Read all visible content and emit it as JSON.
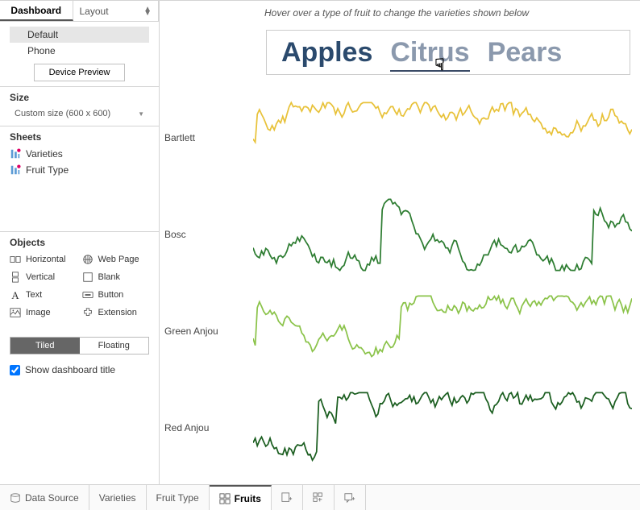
{
  "tabs": {
    "dashboard": "Dashboard",
    "layout": "Layout"
  },
  "devices": {
    "items": [
      "Default",
      "Phone"
    ],
    "preview_btn": "Device Preview"
  },
  "size": {
    "head": "Size",
    "value": "Custom size (600 x 600)"
  },
  "sheets": {
    "head": "Sheets",
    "items": [
      "Varieties",
      "Fruit Type"
    ]
  },
  "objects": {
    "head": "Objects",
    "items": [
      {
        "label": "Horizontal"
      },
      {
        "label": "Web Page"
      },
      {
        "label": "Vertical"
      },
      {
        "label": "Blank"
      },
      {
        "label": "Text"
      },
      {
        "label": "Button"
      },
      {
        "label": "Image"
      },
      {
        "label": "Extension"
      }
    ]
  },
  "placement": {
    "tiled": "Tiled",
    "floating": "Floating"
  },
  "show_title": "Show dashboard title",
  "canvas": {
    "hint": "Hover over a type of fruit to change the varieties shown below",
    "fruits": {
      "apples": "Apples",
      "citrus": "Citrus",
      "pears": "Pears"
    }
  },
  "chart_data": {
    "type": "line",
    "rows": [
      {
        "name": "Bartlett",
        "color": "#e8c23a"
      },
      {
        "name": "Bosc",
        "color": "#2e7d32"
      },
      {
        "name": "Green Anjou",
        "color": "#8bc34a"
      },
      {
        "name": "Red Anjou",
        "color": "#1b5e20"
      }
    ],
    "note": "sparkline-style per-variety time series; exact numeric values not labeled on axes"
  },
  "footer": {
    "data_source": "Data Source",
    "sheets": [
      "Varieties",
      "Fruit Type",
      "Fruits"
    ]
  }
}
